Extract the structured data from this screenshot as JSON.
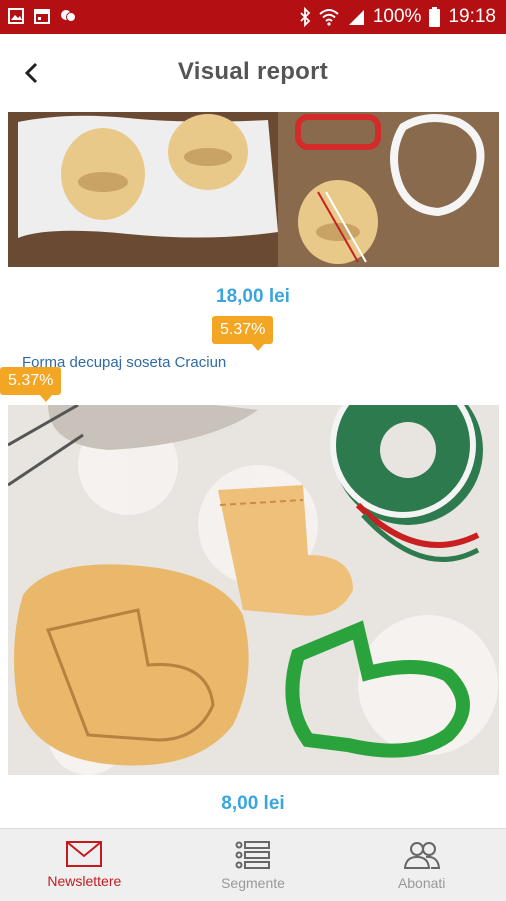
{
  "status_bar": {
    "battery": "100%",
    "time": "19:18"
  },
  "header": {
    "title": "Visual report"
  },
  "items": [
    {
      "price": "18,00 lei",
      "badge": "5.37%"
    },
    {
      "link": "Forma decupaj soseta Craciun",
      "badge": "5.37%",
      "price": "8,00 lei"
    }
  ],
  "nav": [
    {
      "label": "Newslettere",
      "icon": "envelope-icon",
      "active": true
    },
    {
      "label": "Segmente",
      "icon": "list-icon",
      "active": false
    },
    {
      "label": "Abonati",
      "icon": "users-icon",
      "active": false
    }
  ],
  "colors": {
    "status_bar": "#b40f13",
    "accent": "#c41a1e",
    "price": "#3aa6dd",
    "badge": "#f2a623"
  }
}
